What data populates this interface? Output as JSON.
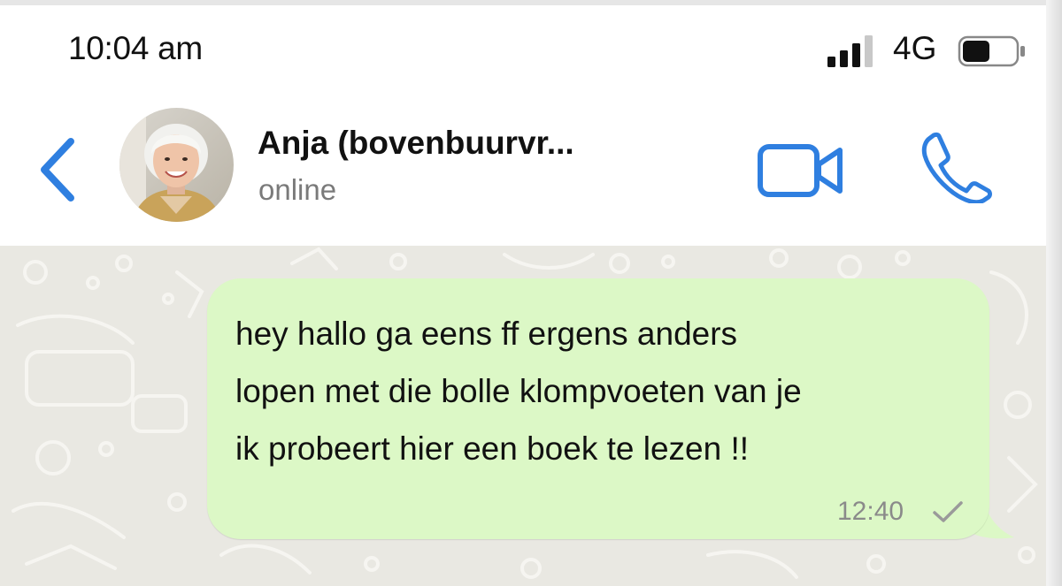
{
  "status_bar": {
    "time": "10:04 am",
    "network": "4G",
    "signal_bars": 4,
    "signal_bars_filled": 3,
    "battery_level": 0.45,
    "icons": [
      "signal-icon",
      "battery-icon"
    ]
  },
  "header": {
    "contact_name": "Anja (bovenbuurvr...",
    "contact_status": "online",
    "icons": [
      "back-chevron-icon",
      "video-call-icon",
      "phone-call-icon"
    ],
    "accent_color": "#2f7fe0"
  },
  "messages": [
    {
      "direction": "outgoing",
      "lines": [
        "hey hallo ga eens ff ergens anders",
        "lopen met die bolle klompvoeten van je",
        "ik probeert hier een boek te lezen !!"
      ],
      "time": "12:40",
      "status_icon": "single-check-icon",
      "bubble_color": "#dcf8c6"
    }
  ],
  "chat": {
    "background_color": "#e9e8e2"
  }
}
